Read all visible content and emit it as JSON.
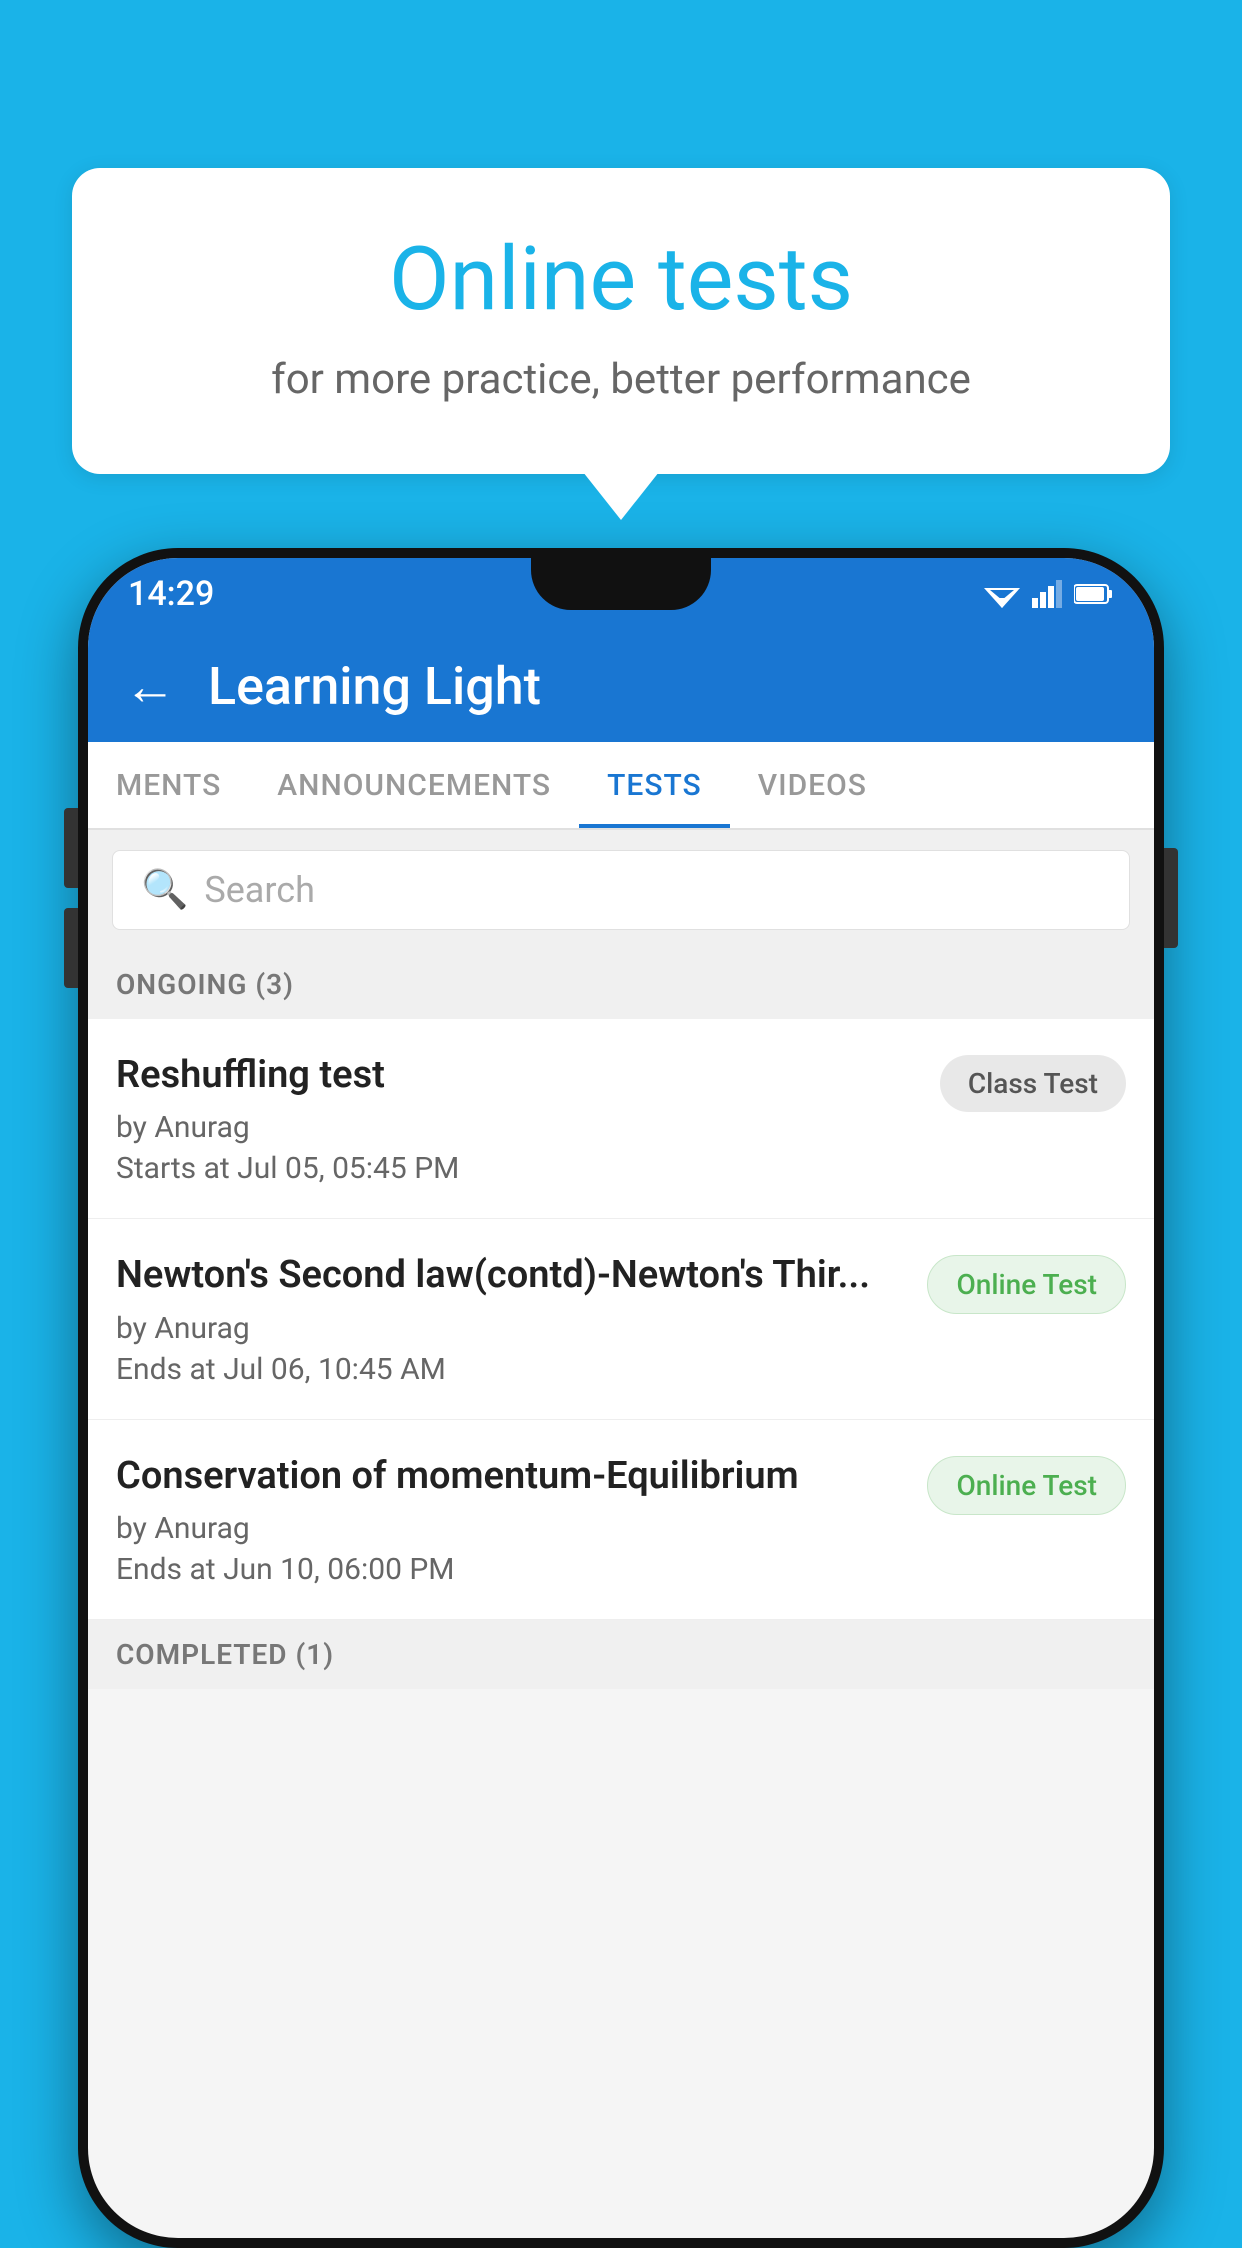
{
  "background": {
    "color": "#1ab3e8"
  },
  "speech_bubble": {
    "title": "Online tests",
    "subtitle": "for more practice, better performance"
  },
  "status_bar": {
    "time": "14:29"
  },
  "app_bar": {
    "title": "Learning Light",
    "back_label": "←"
  },
  "tabs": [
    {
      "label": "MENTS",
      "active": false
    },
    {
      "label": "ANNOUNCEMENTS",
      "active": false
    },
    {
      "label": "TESTS",
      "active": true
    },
    {
      "label": "VIDEOS",
      "active": false
    }
  ],
  "search": {
    "placeholder": "Search"
  },
  "ongoing_section": {
    "header": "ONGOING (3)"
  },
  "tests": [
    {
      "name": "Reshuffling test",
      "author": "by Anurag",
      "time_label": "Starts at",
      "time": "Jul 05, 05:45 PM",
      "badge": "Class Test",
      "badge_type": "class"
    },
    {
      "name": "Newton's Second law(contd)-Newton's Thir...",
      "author": "by Anurag",
      "time_label": "Ends at",
      "time": "Jul 06, 10:45 AM",
      "badge": "Online Test",
      "badge_type": "online"
    },
    {
      "name": "Conservation of momentum-Equilibrium",
      "author": "by Anurag",
      "time_label": "Ends at",
      "time": "Jun 10, 06:00 PM",
      "badge": "Online Test",
      "badge_type": "online"
    }
  ],
  "completed_section": {
    "header": "COMPLETED (1)"
  }
}
